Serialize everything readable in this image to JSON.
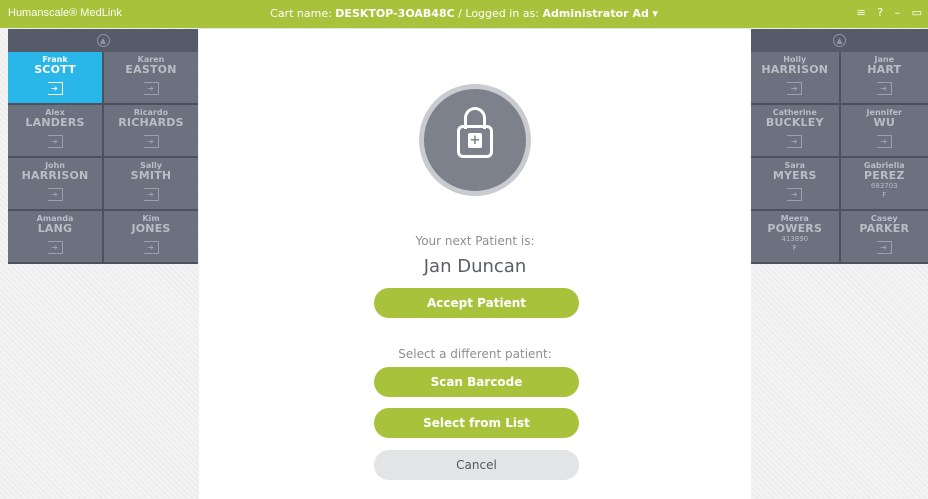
{
  "app": {
    "brand": "Humanscale® MedLink"
  },
  "header": {
    "cart_label": "Cart name:",
    "cart_name": "DESKTOP-3OAB48C",
    "separator": "/",
    "login_label": "Logged in as:",
    "user_name": "Administrator Ad",
    "user_caret": "▾",
    "controls": {
      "menu": "≡",
      "help": "?",
      "minimize": "–",
      "restore": "▭"
    }
  },
  "left_patients": [
    {
      "first": "Frank",
      "last": "SCOTT",
      "mrn": "",
      "sex": "",
      "active": true
    },
    {
      "first": "Karen",
      "last": "EASTON",
      "mrn": "",
      "sex": ""
    },
    {
      "first": "Alex",
      "last": "LANDERS",
      "mrn": "",
      "sex": ""
    },
    {
      "first": "Ricardo",
      "last": "RICHARDS",
      "mrn": "",
      "sex": ""
    },
    {
      "first": "John",
      "last": "HARRISON",
      "mrn": "",
      "sex": ""
    },
    {
      "first": "Sally",
      "last": "SMITH",
      "mrn": "",
      "sex": ""
    },
    {
      "first": "Amanda",
      "last": "LANG",
      "mrn": "",
      "sex": ""
    },
    {
      "first": "Kim",
      "last": "JONES",
      "mrn": "",
      "sex": ""
    }
  ],
  "right_patients": [
    {
      "first": "Holly",
      "last": "HARRISON",
      "mrn": "",
      "sex": ""
    },
    {
      "first": "Jane",
      "last": "HART",
      "mrn": "",
      "sex": ""
    },
    {
      "first": "Catherine",
      "last": "BUCKLEY",
      "mrn": "",
      "sex": ""
    },
    {
      "first": "Jennifer",
      "last": "WU",
      "mrn": "",
      "sex": ""
    },
    {
      "first": "Sara",
      "last": "MYERS",
      "mrn": "",
      "sex": ""
    },
    {
      "first": "Gabriella",
      "last": "PEREZ",
      "mrn": "683703",
      "sex": "F"
    },
    {
      "first": "Meera",
      "last": "POWERS",
      "mrn": "413890",
      "sex": "F"
    },
    {
      "first": "Casey",
      "last": "PARKER",
      "mrn": "",
      "sex": ""
    }
  ],
  "dialog": {
    "next_label": "Your next Patient is:",
    "patient_name": "Jan Duncan",
    "accept_label": "Accept Patient",
    "different_label": "Select a different patient:",
    "scan_label": "Scan Barcode",
    "list_label": "Select from List",
    "cancel_label": "Cancel"
  },
  "colors": {
    "accent": "#a9c23c",
    "active_tile": "#29b6e8",
    "tile": "#6b717e",
    "panel_bg": "#4c515d"
  },
  "icons": {
    "up": "up-arrow-circle-icon",
    "login": "login-arrow-icon",
    "lock": "medical-lock-icon"
  }
}
